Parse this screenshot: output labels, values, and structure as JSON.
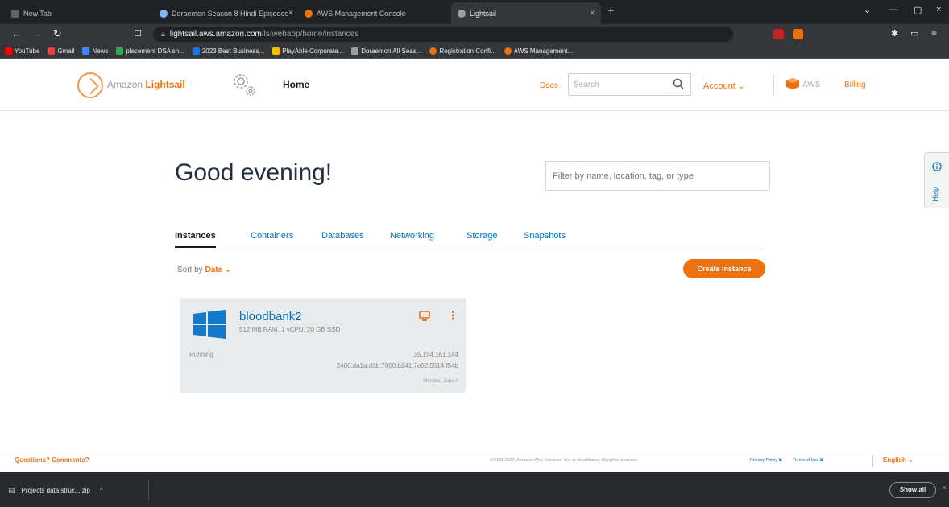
{
  "browser": {
    "tabs": [
      {
        "title": "New Tab",
        "favicon_color": "#5f6368"
      },
      {
        "title": "Doraemon Season 8 Hindi Episodes",
        "favicon_color": "#8ab4f8"
      },
      {
        "title": "AWS Management Console",
        "favicon_color": "#ec7211"
      },
      {
        "title": "Lightsail",
        "favicon_color": "#9aa0a6"
      }
    ],
    "close_glyph": "×",
    "new_tab_glyph": "+",
    "address": {
      "host": "lightsail.aws.amazon.com",
      "path": "/ls/webapp/home/instances"
    },
    "bookmarks": [
      {
        "label": "YouTube",
        "color": "#ff0000"
      },
      {
        "label": "Gmail",
        "color": "#ea4335"
      },
      {
        "label": "News",
        "color": "#4285f4"
      },
      {
        "label": "placement DSA sh...",
        "color": "#34a853"
      },
      {
        "label": "2023 Best Business...",
        "color": "#1a73e8"
      },
      {
        "label": "PlayAble Corporate...",
        "color": "#fbbc04"
      },
      {
        "label": "Doraemon All Seas...",
        "color": "#9aa0a6"
      },
      {
        "label": "Registration Confi...",
        "color": "#ec7211"
      },
      {
        "label": "AWS Management...",
        "color": "#ec7211"
      }
    ]
  },
  "header": {
    "brand_prefix": "Amazon",
    "brand_name": "Lightsail",
    "home": "Home",
    "docs": "Docs",
    "search_placeholder": "Search",
    "account": "Account ⌄",
    "aws": "AWS",
    "billing": "Billing"
  },
  "main": {
    "greeting": "Good evening!",
    "filter_placeholder": "Filter by name, location, tag, or type",
    "tabs": [
      {
        "label": "Instances",
        "active": true
      },
      {
        "label": "Containers",
        "active": false
      },
      {
        "label": "Databases",
        "active": false
      },
      {
        "label": "Networking",
        "active": false
      },
      {
        "label": "Storage",
        "active": false
      },
      {
        "label": "Snapshots",
        "active": false
      }
    ],
    "sort_label": "Sort by",
    "sort_value": "Date ⌄",
    "create_button": "Create instance",
    "instance": {
      "name": "bloodbank2",
      "spec": "512 MB RAM, 1 vCPU, 20 GB SSD",
      "status": "Running",
      "ipv4": "35.154.161.144",
      "ipv6": "2406:da1a:d3b:7800:b241:7e02:5514:f54b",
      "zone": "Mumbai, Zone A"
    }
  },
  "help": {
    "label": "Help"
  },
  "footer": {
    "questions": "Questions? Comments?",
    "copyright": "©2008-2023, Amazon Web Services, Inc. or its affiliates. All rights reserved.",
    "privacy": "Privacy Policy ⧉",
    "terms": "Terms of Use ⧉",
    "language": "English ⌄"
  },
  "downloads": {
    "file": "Projects data struc....zip",
    "show_all": "Show all",
    "close_glyph": "×"
  },
  "colors": {
    "accent": "#ec7211",
    "link": "#0073bb",
    "windows_blue": "#1479c9"
  }
}
